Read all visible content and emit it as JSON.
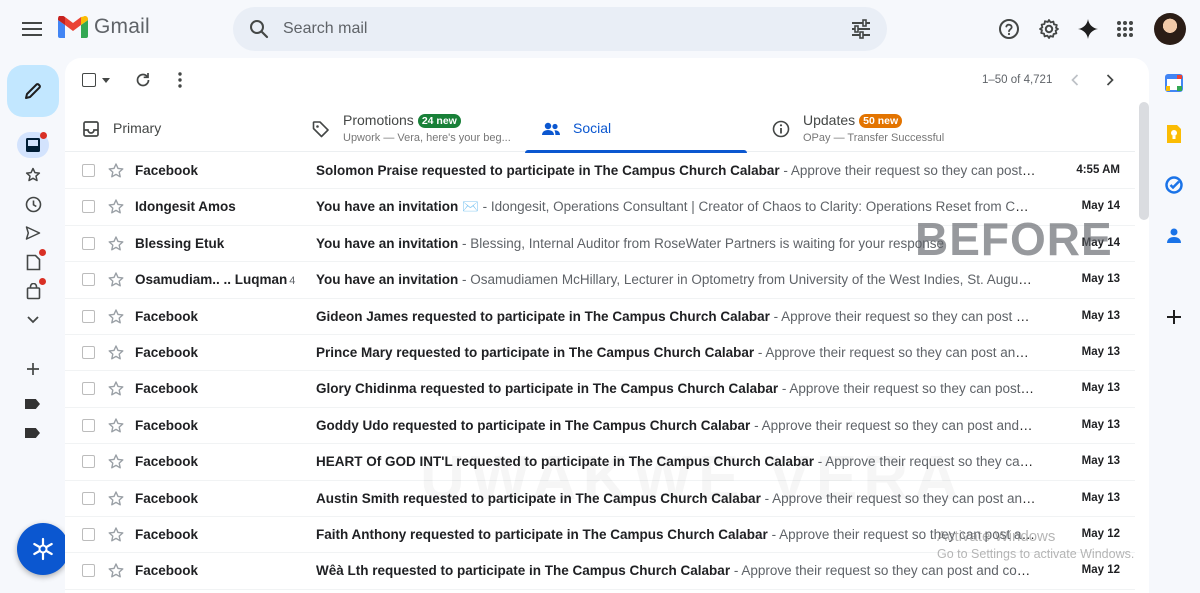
{
  "app": {
    "name": "Gmail"
  },
  "search": {
    "placeholder": "Search mail"
  },
  "toolbar": {
    "pager": "1–50 of 4,721"
  },
  "tabs": [
    {
      "label": "Primary"
    },
    {
      "label": "Promotions",
      "badge": "24 new",
      "badge_color": "#188038",
      "subtitle": "Upwork — Vera, here's your beg..."
    },
    {
      "label": "Social",
      "active": true
    },
    {
      "label": "Updates",
      "badge": "50 new",
      "badge_color": "#e37400",
      "subtitle": "OPay — Transfer Successful"
    }
  ],
  "emails": [
    {
      "sender": "Facebook",
      "count": "",
      "subject": "Solomon Praise requested to participate in The Campus Church Calabar",
      "snippet": " - Approve their request so they can post and comment.",
      "date": "4:55 AM"
    },
    {
      "sender": "Idongesit Amos",
      "count": "",
      "subject": "You have an invitation ✉️",
      "snippet": " - Idongesit, Operations Consultant | Creator of Chaos to Clarity: Operations Reset from Chaos to Clarity",
      "date": "May 14"
    },
    {
      "sender": "Blessing Etuk",
      "count": "",
      "subject": "You have an invitation",
      "snippet": " - Blessing, Internal Auditor from RoseWater Partners is waiting for your response",
      "date": "May 14"
    },
    {
      "sender": "Osamudiam.. .. Luqman",
      "count": "4",
      "subject": "You have an invitation",
      "snippet": " - Osamudiamen McHillary, Lecturer in Optometry from University of the West Indies, St. Augustine Campus",
      "date": "May 13"
    },
    {
      "sender": "Facebook",
      "count": "",
      "subject": "Gideon James requested to participate in The Campus Church Calabar",
      "snippet": " - Approve their request so they can post and comment.",
      "date": "May 13"
    },
    {
      "sender": "Facebook",
      "count": "",
      "subject": "Prince Mary requested to participate in The Campus Church Calabar",
      "snippet": " - Approve their request so they can post and comment.",
      "date": "May 13"
    },
    {
      "sender": "Facebook",
      "count": "",
      "subject": "Glory Chidinma requested to participate in The Campus Church Calabar",
      "snippet": " - Approve their request so they can post and comment.",
      "date": "May 13"
    },
    {
      "sender": "Facebook",
      "count": "",
      "subject": "Goddy Udo requested to participate in The Campus Church Calabar",
      "snippet": " - Approve their request so they can post and comment.",
      "date": "May 13"
    },
    {
      "sender": "Facebook",
      "count": "",
      "subject": "HEART Of GOD INT'L requested to participate in The Campus Church Calabar",
      "snippet": " - Approve their request so they can post and comment.",
      "date": "May 13"
    },
    {
      "sender": "Facebook",
      "count": "",
      "subject": "Austin Smith requested to participate in The Campus Church Calabar",
      "snippet": " - Approve their request so they can post and comment.",
      "date": "May 13"
    },
    {
      "sender": "Facebook",
      "count": "",
      "subject": "Faith Anthony requested to participate in The Campus Church Calabar",
      "snippet": " - Approve their request so they can post and comment.",
      "date": "May 12"
    },
    {
      "sender": "Facebook",
      "count": "",
      "subject": "Wêà Lth requested to participate in The Campus Church Calabar",
      "snippet": " - Approve their request so they can post and comment.",
      "date": "May 12"
    }
  ],
  "overlays": {
    "before": "BEFORE",
    "name_watermark": "UWAKWE VERA",
    "activate_title": "Activate Windows",
    "activate_sub": "Go to Settings to activate Windows."
  },
  "icons": {
    "menu": "hamburger-menu-icon",
    "logo": "gmail-m-logo",
    "search": "search-icon",
    "filter": "tune-icon",
    "help": "help-circle-icon",
    "settings": "gear-icon",
    "gemini": "sparkle-icon",
    "apps": "apps-grid-icon"
  },
  "colors": {
    "accent": "#0b57d0",
    "compose_bg": "#c2e7ff",
    "background": "#f6f8fc"
  }
}
